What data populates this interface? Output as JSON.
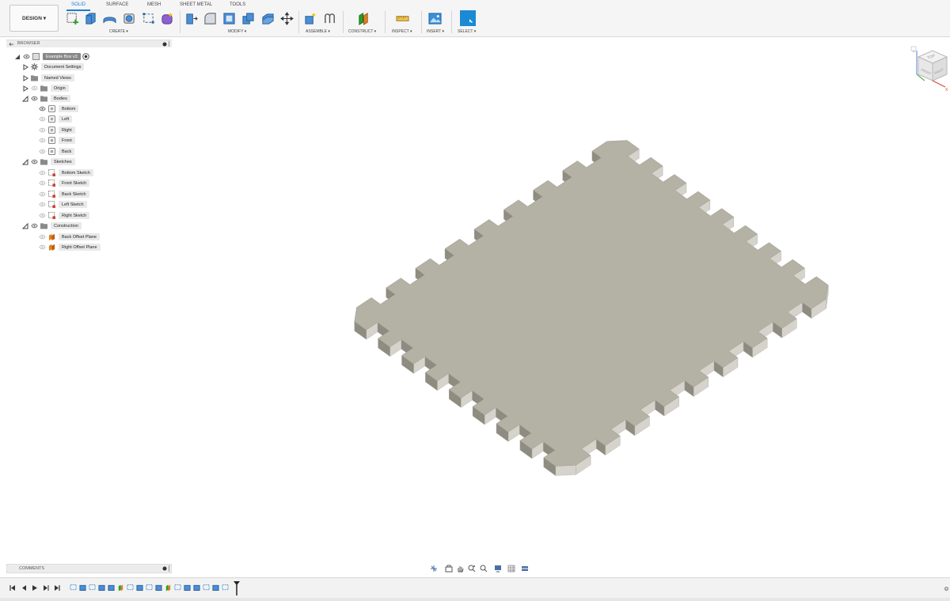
{
  "toolbar": {
    "design_label": "DESIGN ▾",
    "tabs": [
      {
        "label": "SOLID",
        "active": true
      },
      {
        "label": "SURFACE",
        "active": false
      },
      {
        "label": "MESH",
        "active": false
      },
      {
        "label": "SHEET METAL",
        "active": false
      },
      {
        "label": "TOOLS",
        "active": false
      }
    ],
    "groups": {
      "create": "CREATE ▾",
      "modify": "MODIFY ▾",
      "assemble": "ASSEMBLE ▾",
      "construct": "CONSTRUCT ▾",
      "inspect": "INSPECT ▾",
      "insert": "INSERT ▾",
      "select": "SELECT ▾"
    },
    "accent_color": "#1a7dd0"
  },
  "browser": {
    "title": "BROWSER",
    "root": "Example Box v3",
    "items": [
      {
        "label": "Document Settings",
        "icon": "gear-icon"
      },
      {
        "label": "Named Views",
        "icon": "folder-icon"
      },
      {
        "label": "Origin",
        "icon": "folder-icon"
      },
      {
        "label": "Bodies",
        "icon": "folder-icon"
      },
      {
        "label": "Bottom",
        "icon": "body-icon"
      },
      {
        "label": "Left",
        "icon": "body-icon"
      },
      {
        "label": "Right",
        "icon": "body-icon"
      },
      {
        "label": "Front",
        "icon": "body-icon"
      },
      {
        "label": "Back",
        "icon": "body-icon"
      },
      {
        "label": "Sketches",
        "icon": "folder-icon"
      },
      {
        "label": "Bottom Sketch",
        "icon": "sketch-icon"
      },
      {
        "label": "Front Sketch",
        "icon": "sketch-icon"
      },
      {
        "label": "Back Sketch",
        "icon": "sketch-icon"
      },
      {
        "label": "Left Sketch",
        "icon": "sketch-icon"
      },
      {
        "label": "Right Sketch",
        "icon": "sketch-icon"
      },
      {
        "label": "Construction",
        "icon": "folder-icon"
      },
      {
        "label": "Back Offset Plane",
        "icon": "plane-icon"
      },
      {
        "label": "Right Offset Plane",
        "icon": "plane-icon"
      }
    ]
  },
  "comments": {
    "title": "COMMENTS"
  },
  "viewcube": {
    "top_label": "TOP",
    "front_label": "FRONT",
    "right_label": "RIGHT",
    "axis_z": "Z",
    "axis_x": "X"
  },
  "model": {
    "face_color": "#b4b1a5",
    "side_color": "#d5d3cb",
    "dark_side_color": "#8e8b80"
  }
}
